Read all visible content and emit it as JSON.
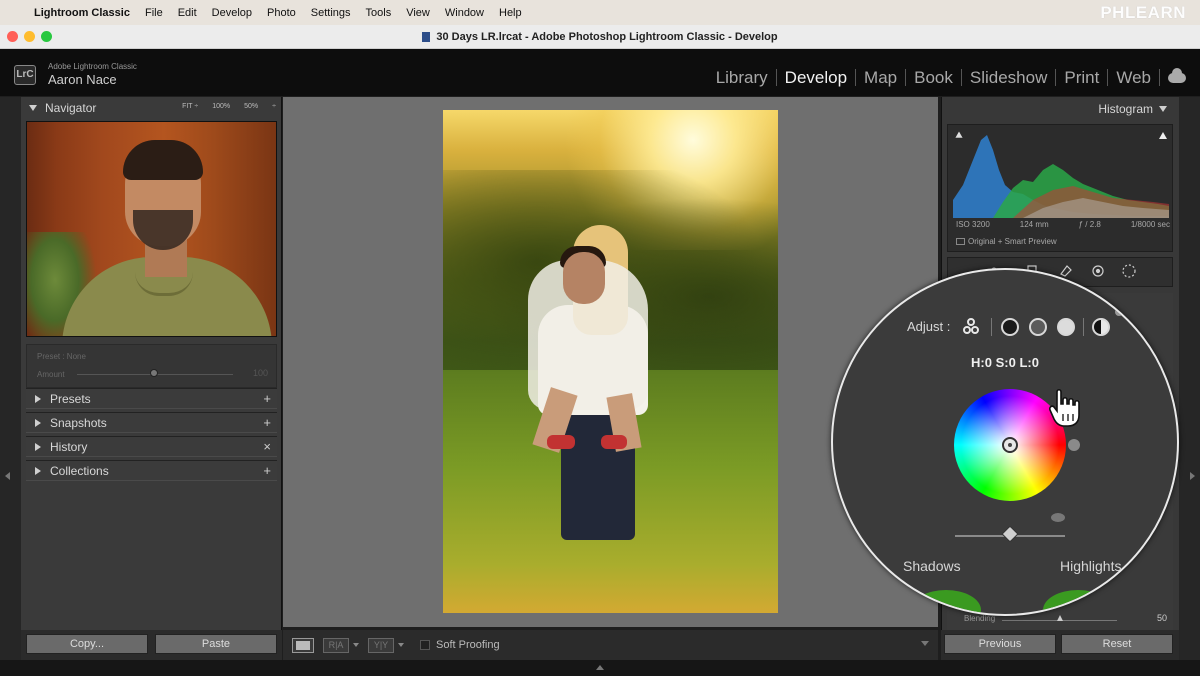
{
  "menubar": {
    "apple": "",
    "items": [
      "Lightroom Classic",
      "File",
      "Edit",
      "Develop",
      "Photo",
      "Settings",
      "Tools",
      "View",
      "Window",
      "Help"
    ],
    "watermark": "PHLEARN"
  },
  "window": {
    "title": "30 Days LR.lrcat - Adobe Photoshop Lightroom Classic - Develop"
  },
  "identity": {
    "logo": "LrC",
    "product": "Adobe Lightroom Classic",
    "user": "Aaron Nace"
  },
  "modules": {
    "items": [
      "Library",
      "Develop",
      "Map",
      "Book",
      "Slideshow",
      "Print",
      "Web"
    ],
    "active": "Develop"
  },
  "left_panel": {
    "navigator_label": "Navigator",
    "zoom_options": [
      "FIT ÷",
      "100%",
      "50%",
      "÷"
    ],
    "preset_label": "Preset : None",
    "amount_label": "Amount",
    "amount_value": "100",
    "amount_fraction": 1.0,
    "sections": [
      {
        "label": "Presets",
        "action": "+"
      },
      {
        "label": "Snapshots",
        "action": "+"
      },
      {
        "label": "History",
        "action": "×"
      },
      {
        "label": "Collections",
        "action": "+"
      }
    ],
    "copy_label": "Copy...",
    "paste_label": "Paste"
  },
  "toolbar": {
    "ra_label": "R|A",
    "yy_label": "Y|Y",
    "soft_proofing_label": "Soft Proofing",
    "soft_proofing_checked": false
  },
  "right_panel": {
    "histogram_label": "Histogram",
    "iso": "ISO 3200",
    "focal": "124 mm",
    "aperture": "ƒ / 2.8",
    "shutter": "1/8000 sec",
    "preview_label": "Original + Smart Preview",
    "blending_label": "Blending",
    "blending_value": "50",
    "previous_label": "Previous",
    "reset_label": "Reset"
  },
  "color_grading": {
    "adjust_label": "Adjust :",
    "hsl_readout": "H:0 S:0 L:0",
    "shadows_label": "Shadows",
    "highlights_label": "Highlights",
    "luminance_fraction": 0.5
  },
  "colors": {
    "panel_bg": "#3a3a3a",
    "canvas_bg": "#6f6f6f",
    "active_module": "#f2f2f2",
    "inactive_module": "#a8a8a8"
  }
}
